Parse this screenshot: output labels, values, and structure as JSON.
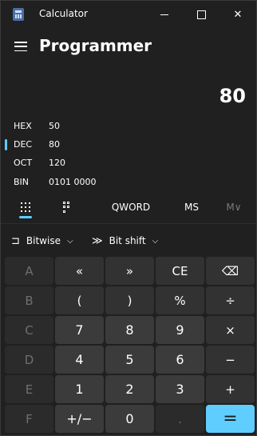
{
  "window": {
    "title": "Calculator"
  },
  "header": {
    "mode": "Programmer"
  },
  "display": {
    "value": "80"
  },
  "bases": [
    {
      "label": "HEX",
      "value": "50",
      "selected": false
    },
    {
      "label": "DEC",
      "value": "80",
      "selected": true
    },
    {
      "label": "OCT",
      "value": "120",
      "selected": false
    },
    {
      "label": "BIN",
      "value": "0101 0000",
      "selected": false
    }
  ],
  "tabs": {
    "keypad_icon": "full-keypad-icon",
    "bitflip_icon": "bit-toggling-keypad-icon",
    "word": "QWORD",
    "ms": "MS",
    "mv": "M∨"
  },
  "bitwise": {
    "label": "Bitwise",
    "icon": "logic-gate-icon"
  },
  "bitshift": {
    "label": "Bit shift",
    "icon": "bit-shift-icon"
  },
  "keypad": {
    "rows": [
      [
        "A",
        "«",
        "»",
        "CE",
        "⌫"
      ],
      [
        "B",
        "(",
        ")",
        "%",
        "÷"
      ],
      [
        "C",
        "7",
        "8",
        "9",
        "×"
      ],
      [
        "D",
        "4",
        "5",
        "6",
        "−"
      ],
      [
        "E",
        "1",
        "2",
        "3",
        "+"
      ],
      [
        "F",
        "+/−",
        "0",
        ".",
        "="
      ]
    ]
  },
  "colors": {
    "accent": "#60cdff",
    "background": "#202020"
  }
}
